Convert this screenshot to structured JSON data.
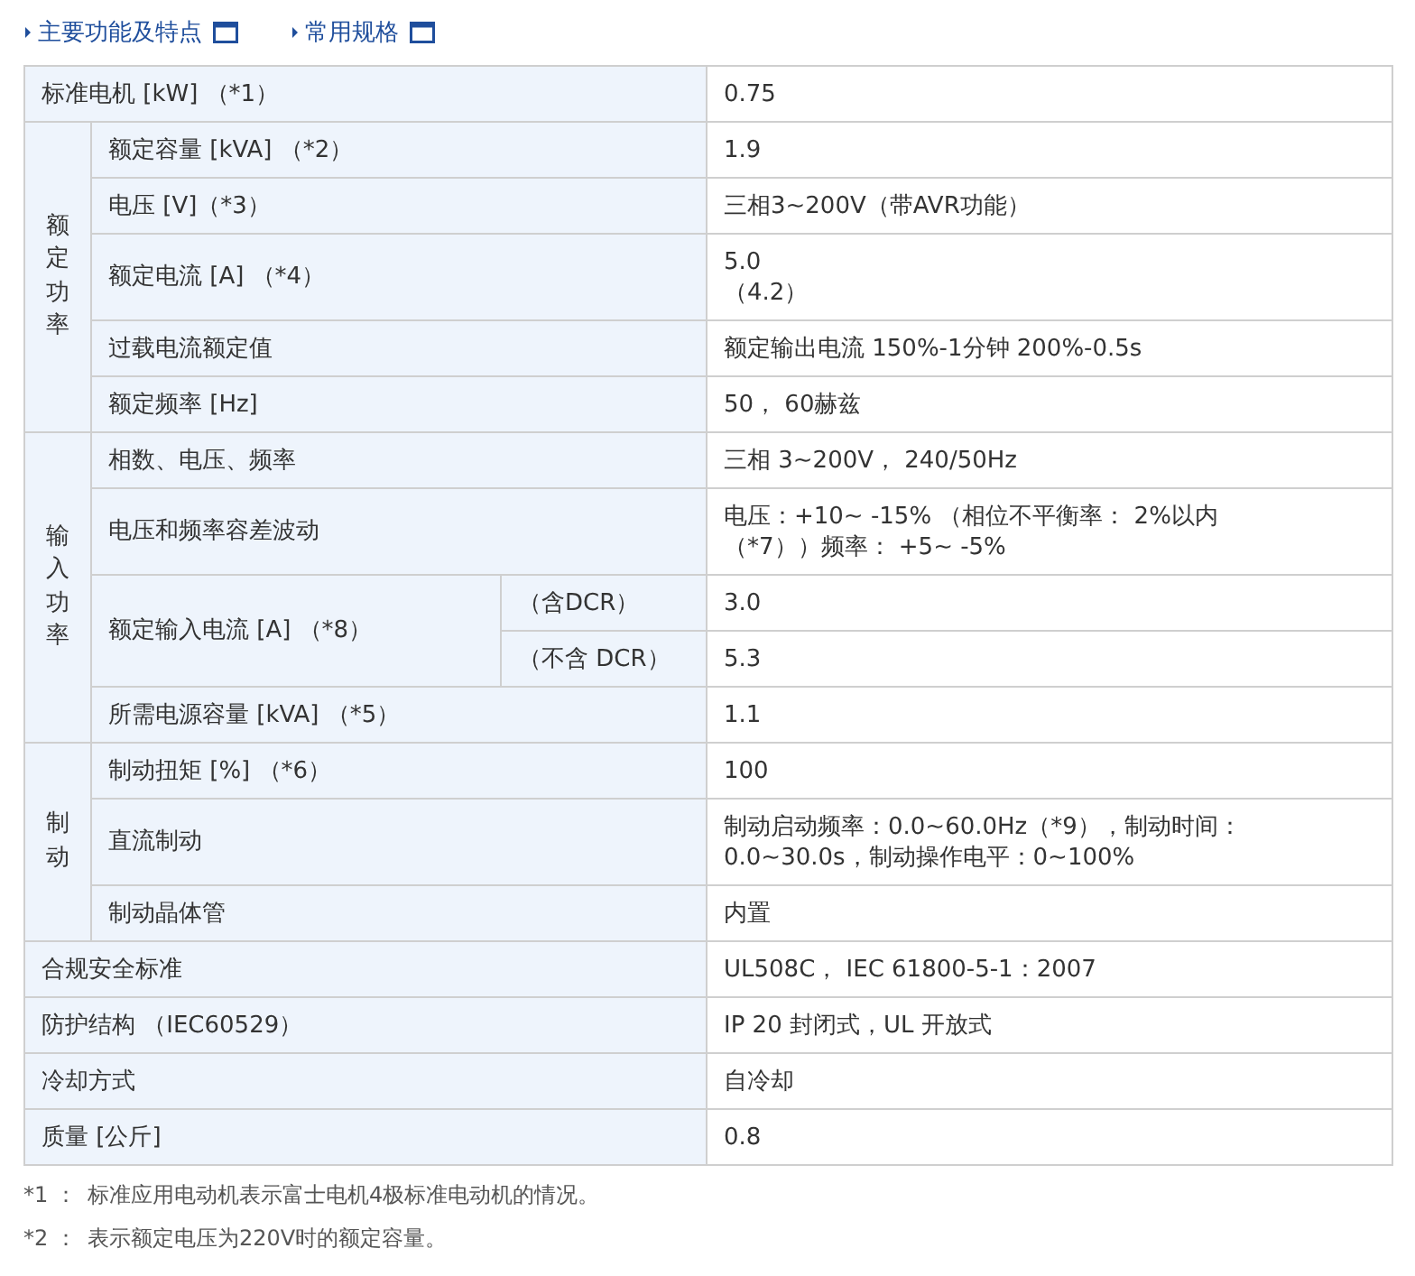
{
  "links": [
    {
      "label": "主要功能及特点"
    },
    {
      "label": "常用规格"
    }
  ],
  "rows": [
    {
      "kind": "plain",
      "label": "标准电机 [kW] （*1）",
      "lines": [
        "0.75"
      ]
    },
    {
      "kind": "group",
      "group": "额定功率",
      "items": [
        {
          "label": "额定容量 [kVA] （*2）",
          "lines": [
            "1.9"
          ]
        },
        {
          "label": "电压 [V]（*3）",
          "lines": [
            "三相3~200V（带AVR功能）"
          ]
        },
        {
          "label": "额定电流 [A] （*4）",
          "lines": [
            "5.0",
            "（4.2）"
          ]
        },
        {
          "label": "过载电流额定值",
          "lines": [
            "额定输出电流 150%-1分钟 200%-0.5s"
          ]
        },
        {
          "label": "额定频率 [Hz]",
          "lines": [
            "50， 60赫兹"
          ]
        }
      ]
    },
    {
      "kind": "group",
      "group": "输入功率",
      "items": [
        {
          "label": "相数、电压、频率",
          "lines": [
            "三相 3~200V， 240/50Hz"
          ]
        },
        {
          "label": "电压和频率容差波动",
          "lines": [
            "电压：+10~ -15% （相位不平衡率： 2%以内",
            "（*7））频率： +5~ -5%"
          ]
        },
        {
          "label": "额定输入电流 [A] （*8）",
          "variants": [
            {
              "label": "（含DCR）",
              "lines": [
                "3.0"
              ]
            },
            {
              "label": "（不含 DCR）",
              "lines": [
                "5.3"
              ]
            }
          ]
        },
        {
          "label": "所需电源容量 [kVA] （*5）",
          "lines": [
            "1.1"
          ]
        }
      ]
    },
    {
      "kind": "group",
      "group": "制动",
      "items": [
        {
          "label": "制动扭矩 [%] （*6）",
          "lines": [
            "100"
          ]
        },
        {
          "label": "直流制动",
          "lines": [
            "制动启动频率：0.0~60.0Hz（*9），制动时间：",
            "0.0~30.0s，制动操作电平：0~100%"
          ]
        },
        {
          "label": "制动晶体管",
          "lines": [
            "内置"
          ]
        }
      ]
    },
    {
      "kind": "plain",
      "label": "合规安全标准",
      "lines": [
        "UL508C， IEC 61800-5-1：2007"
      ]
    },
    {
      "kind": "plain",
      "label": "防护结构 （IEC60529）",
      "lines": [
        "IP 20 封闭式，UL 开放式"
      ]
    },
    {
      "kind": "plain",
      "label": "冷却方式",
      "lines": [
        "自冷却"
      ]
    },
    {
      "kind": "plain",
      "label": "质量 [公斤]",
      "lines": [
        "0.8"
      ]
    }
  ],
  "footnotes": [
    {
      "mark": "*1 ：",
      "text": "标准应用电动机表示富士电机4极标准电动机的情况。"
    },
    {
      "mark": "*2 ：",
      "text": "表示额定电压为220V时的额定容量。"
    }
  ]
}
